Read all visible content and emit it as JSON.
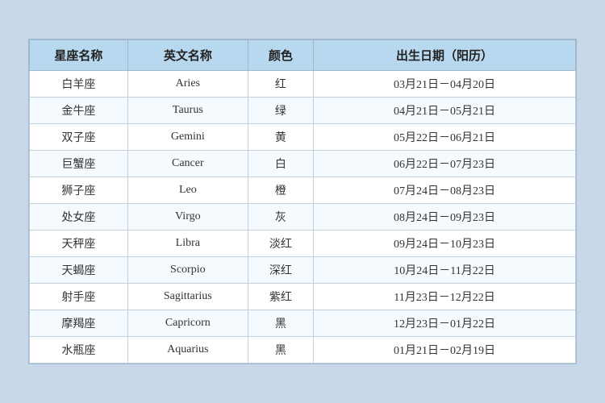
{
  "table": {
    "headers": {
      "chinese_name": "星座名称",
      "english_name": "英文名称",
      "color": "颜色",
      "birthdate": "出生日期（阳历）"
    },
    "rows": [
      {
        "chinese": "白羊座",
        "english": "Aries",
        "color": "红",
        "date": "03月21日－04月20日"
      },
      {
        "chinese": "金牛座",
        "english": "Taurus",
        "color": "绿",
        "date": "04月21日－05月21日"
      },
      {
        "chinese": "双子座",
        "english": "Gemini",
        "color": "黄",
        "date": "05月22日－06月21日"
      },
      {
        "chinese": "巨蟹座",
        "english": "Cancer",
        "color": "白",
        "date": "06月22日－07月23日"
      },
      {
        "chinese": "狮子座",
        "english": "Leo",
        "color": "橙",
        "date": "07月24日－08月23日"
      },
      {
        "chinese": "处女座",
        "english": "Virgo",
        "color": "灰",
        "date": "08月24日－09月23日"
      },
      {
        "chinese": "天秤座",
        "english": "Libra",
        "color": "淡红",
        "date": "09月24日－10月23日"
      },
      {
        "chinese": "天蝎座",
        "english": "Scorpio",
        "color": "深红",
        "date": "10月24日－11月22日"
      },
      {
        "chinese": "射手座",
        "english": "Sagittarius",
        "color": "紫红",
        "date": "11月23日－12月22日"
      },
      {
        "chinese": "摩羯座",
        "english": "Capricorn",
        "color": "黑",
        "date": "12月23日－01月22日"
      },
      {
        "chinese": "水瓶座",
        "english": "Aquarius",
        "color": "黑",
        "date": "01月21日－02月19日"
      }
    ]
  }
}
